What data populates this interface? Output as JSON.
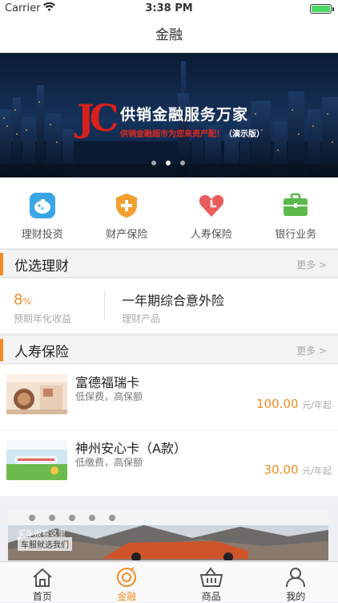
{
  "status": {
    "carrier": "Carrier",
    "time": "3:38 PM"
  },
  "nav": {
    "title": "金融"
  },
  "banner": {
    "logo": "JC",
    "headline": "供销金融服务万家",
    "subline_red": "供销金融超市为您来资产配！",
    "subline_tag": "（演示版）",
    "slide_count": 3,
    "active_slide": 2
  },
  "quick": [
    {
      "label": "理财投资",
      "icon": "piggy-bank-icon",
      "color": "#3aa6e6"
    },
    {
      "label": "财产保险",
      "icon": "shield-plus-icon",
      "color": "#f3a030"
    },
    {
      "label": "人寿保险",
      "icon": "heart-clock-icon",
      "color": "#ec5b5b"
    },
    {
      "label": "银行业务",
      "icon": "briefcase-icon",
      "color": "#5bb94a"
    }
  ],
  "section_finance": {
    "title": "优选理财",
    "more": "更多 >"
  },
  "finance_item": {
    "rate": "8",
    "rate_unit": "%",
    "rate_label": "预期年化收益",
    "name": "一年期综合意外险",
    "type": "理财产品"
  },
  "section_life": {
    "title": "人寿保险",
    "more": "更多 >"
  },
  "insurance": [
    {
      "name": "富德福瑞卡",
      "desc": "低保费，高保额",
      "price": "100.00",
      "unit": "元/年起"
    },
    {
      "name": "神州安心卡（A款）",
      "desc": "低缴费，高保额",
      "price": "30.00",
      "unit": "元/年起"
    }
  ],
  "ad": {
    "line1": "买车报看这里",
    "line2": "车服就选我们"
  },
  "tabs": [
    {
      "label": "首页",
      "icon": "home-icon"
    },
    {
      "label": "金融",
      "icon": "finance-icon",
      "active": true
    },
    {
      "label": "商品",
      "icon": "basket-icon"
    },
    {
      "label": "我的",
      "icon": "user-icon"
    }
  ],
  "colors": {
    "accent": "#f08c22",
    "banner": "#15325c"
  }
}
